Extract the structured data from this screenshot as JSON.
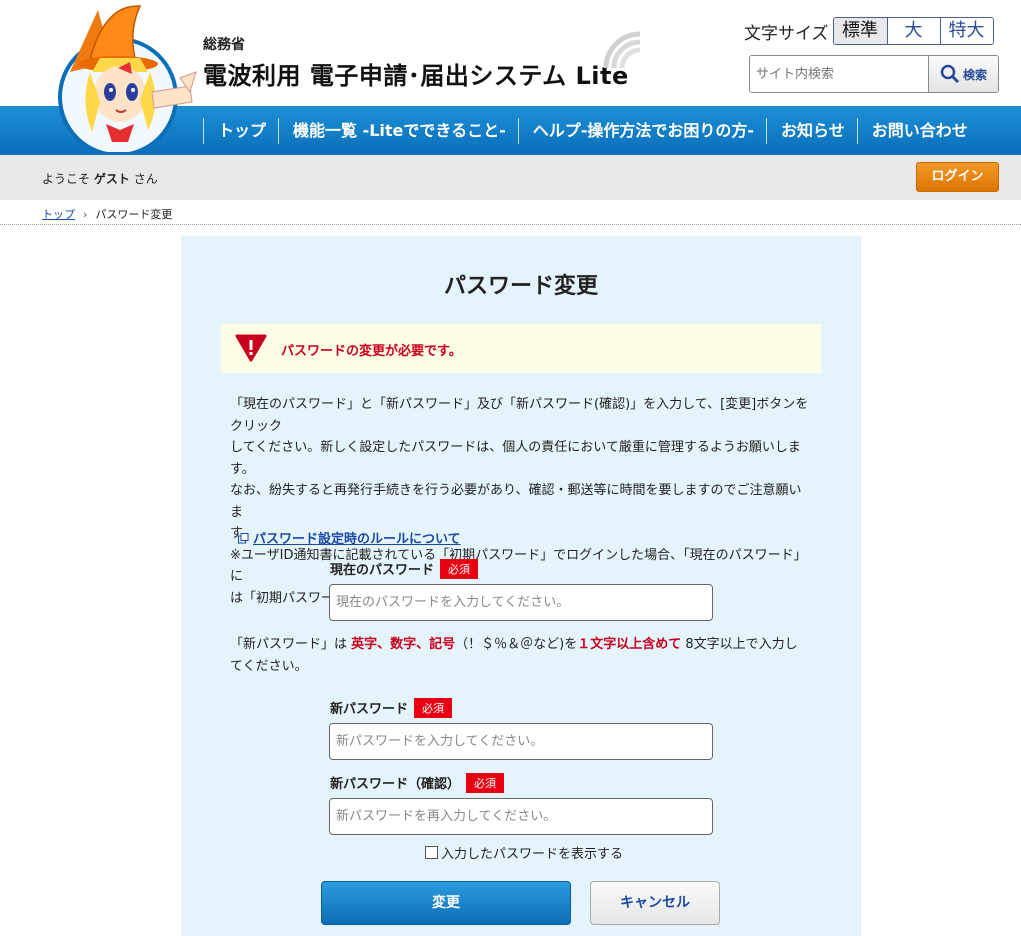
{
  "header": {
    "ministry": "総務省",
    "site_title": "電波利用 電子申請･届出システム Lite",
    "font_size_label": "文字サイズ",
    "font_size_options": [
      "標準",
      "大",
      "特大"
    ],
    "search_placeholder": "サイト内検索",
    "search_button": "検索"
  },
  "nav": {
    "items": [
      "トップ",
      "機能一覧 -Liteでできること-",
      "ヘルプ-操作方法でお困りの方-",
      "お知らせ",
      "お問い合わせ"
    ]
  },
  "welcome": {
    "prefix": "ようこそ",
    "user": "ゲスト",
    "suffix": "さん",
    "login_button": "ログイン"
  },
  "breadcrumb": {
    "top": "トップ",
    "current": "パスワード変更"
  },
  "main": {
    "title": "パスワード変更",
    "alert": "パスワードの変更が必要です。",
    "description": [
      "「現在のパスワード」と「新パスワード」及び「新パスワード(確認)」を入力して、[変更]ボタンをクリック",
      "してください。新しく設定したパスワードは、個人の責任において厳重に管理するようお願いします。",
      "なお、紛失すると再発行手続きを行う必要があり、確認・郵送等に時間を要しますのでご注意願いま",
      "す",
      "※ユーザID通知書に記載されている「初期パスワード」でログインした場合、「現在のパスワード」に",
      "は「初期パスワード」を入力してください。"
    ],
    "rule_link": "パスワード設定時のルールについて",
    "required_badge": "必須",
    "current_password": {
      "label": "現在のパスワード",
      "placeholder": "現在のパスワードを入力してください。"
    },
    "hint": {
      "part1": "「新パスワード」は",
      "red1": "英字、数字、記号",
      "part2": "（！＄％＆＠など)を",
      "red2": "１文字以上含めて",
      "part3": "8文字以上で入力し",
      "line2": "てください。"
    },
    "new_password": {
      "label": "新パスワード",
      "placeholder": "新パスワードを入力してください。"
    },
    "confirm_password": {
      "label": "新パスワード（確認）",
      "placeholder": "新パスワードを再入力してください。"
    },
    "show_password": "入力したパスワードを表示する",
    "change_button": "変更",
    "cancel_button": "キャンセル"
  },
  "colors": {
    "nav_blue": "#0a6fb8",
    "login_orange": "#e67e00",
    "panel_bg": "#e5f4fb",
    "alert_red": "#c8001e"
  }
}
